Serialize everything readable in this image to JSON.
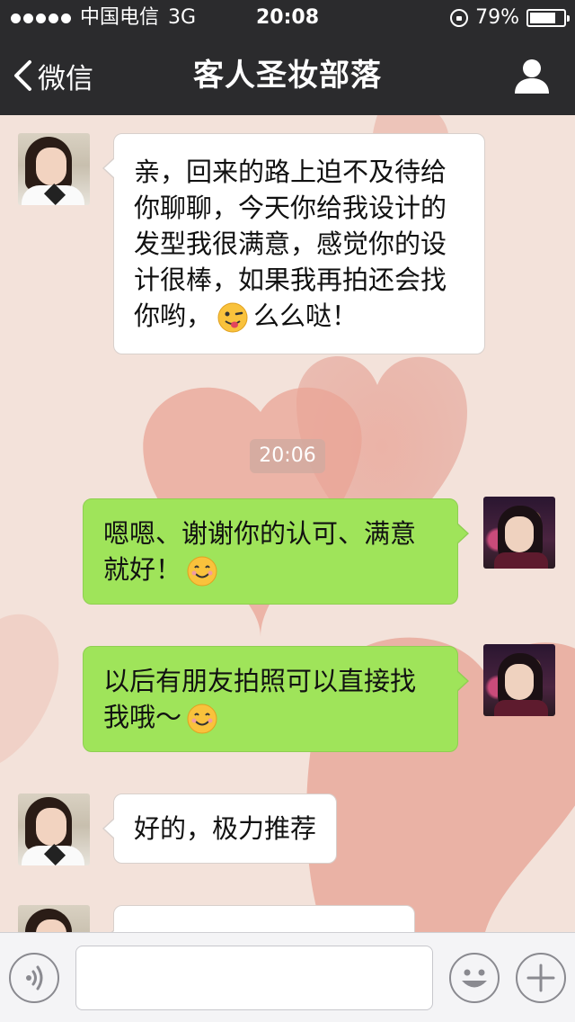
{
  "status_bar": {
    "carrier": "中国电信",
    "network": "3G",
    "time": "20:08",
    "battery": "79%",
    "battery_level": 0.79,
    "signal_dots": 5
  },
  "nav": {
    "back_label": "微信",
    "title": "客人圣妆部落",
    "profile_icon": "person-icon"
  },
  "messages": [
    {
      "side": "in",
      "avatar": "contact-avatar",
      "text_parts": [
        "亲，回来的路上迫不及待给你聊聊，今天你给我设计的发型我很满意，感觉你的设计很棒，如果我再拍还会找你哟，",
        "么么哒！"
      ],
      "emoji": "wink-tongue-emoji"
    },
    {
      "side": "out",
      "avatar": "my-avatar",
      "text": "嗯嗯、谢谢你的认可、满意就好！",
      "emoji": "smile-emoji"
    },
    {
      "side": "out",
      "avatar": "my-avatar",
      "text": "以后有朋友拍照可以直接找我哦～",
      "emoji": "smile-emoji"
    },
    {
      "side": "in",
      "avatar": "contact-avatar",
      "text": "好的，极力推荐"
    }
  ],
  "timestamp": "20:06",
  "input_bar": {
    "voice_icon": "voice-icon",
    "emoji_icon": "emoji-icon",
    "plus_icon": "plus-icon",
    "placeholder": ""
  },
  "colors": {
    "bar_bg": "#2b2b2d",
    "chat_bg": "#f3e2da",
    "bubble_out": "#9fe45a",
    "bubble_in": "#ffffff"
  }
}
